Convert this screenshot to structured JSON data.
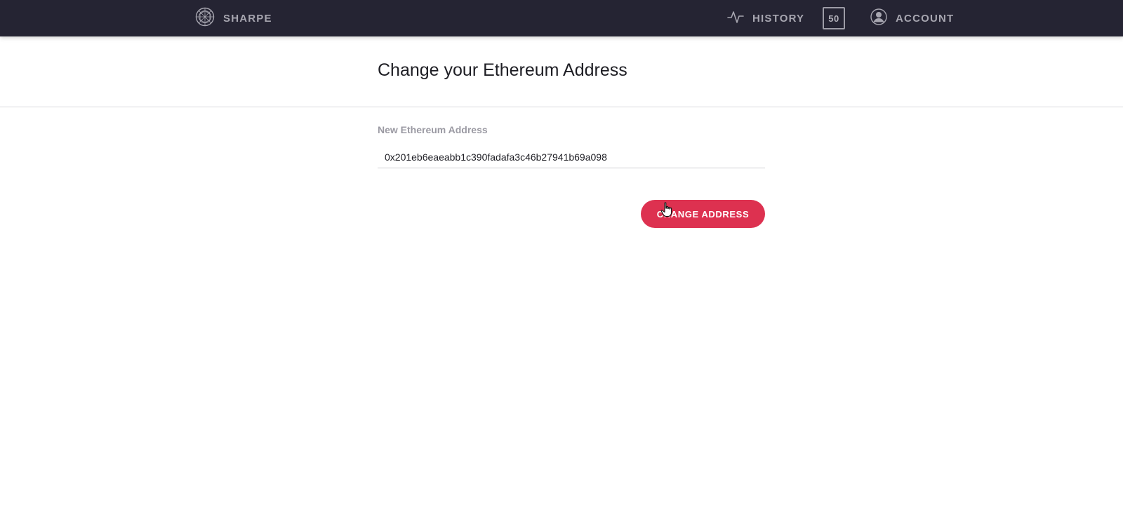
{
  "header": {
    "brand": "SHARPE",
    "brand_icon": "sharpe-logo-icon",
    "nav": {
      "history_label": "HISTORY",
      "history_icon": "activity-pulse-icon",
      "counter_value": "50",
      "account_label": "ACCOUNT",
      "account_icon": "user-avatar-icon"
    }
  },
  "page": {
    "title": "Change your Ethereum Address"
  },
  "form": {
    "field_label": "New Ethereum Address",
    "address_value": "0x201eb6eaeabb1c390fadafa3c46b27941b69a098",
    "submit_label": "CHANGE ADDRESS"
  },
  "colors": {
    "topbar": "#252433",
    "accent": "#dd3150",
    "nav_text": "#a7a6b0"
  }
}
